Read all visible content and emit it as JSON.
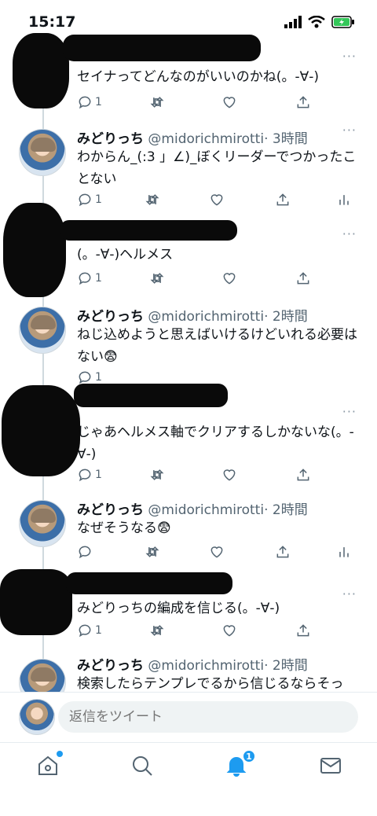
{
  "status_bar": {
    "time": "15:17"
  },
  "more_label": "···",
  "tweets": [
    {
      "name": "",
      "handle": "",
      "time": "",
      "text": "セイナってどんなのがいいのかね(。-∀-)",
      "reply_count": "1",
      "redacted": true
    },
    {
      "name": "みどりっち",
      "handle": "@midorichmirotti",
      "time": "· 3時間",
      "text": "わからん_(:3 」∠)_ぼくリーダーでつかったことない",
      "reply_count": "1",
      "redacted": false
    },
    {
      "name": "",
      "handle": "",
      "time": "",
      "text": "(。-∀-)ヘルメス",
      "reply_count": "1",
      "redacted": true
    },
    {
      "name": "みどりっち",
      "handle": "@midorichmirotti",
      "time": "· 2時間",
      "text": "ねじ込めようと思えばいけるけどいれる必要はない😨",
      "reply_count": "1",
      "redacted": false
    },
    {
      "name": "",
      "handle": "",
      "time": "",
      "text": "じゃあヘルメス軸でクリアするしかないな(。-∀-)",
      "reply_count": "1",
      "redacted": true
    },
    {
      "name": "みどりっち",
      "handle": "@midorichmirotti",
      "time": "· 2時間",
      "text": "なぜそうなる😨",
      "reply_count": "",
      "redacted": false
    },
    {
      "name": "",
      "handle": "",
      "time": "",
      "text": "みどりっちの編成を信じる(。-∀-)",
      "reply_count": "1",
      "redacted": true
    },
    {
      "name": "みどりっち",
      "handle": "@midorichmirotti",
      "time": "· 2時間",
      "text": "検索したらテンプレでるから信じるならそっ",
      "reply_count": "",
      "redacted": false
    }
  ],
  "reply": {
    "placeholder": "返信をツイート"
  },
  "tabs": {
    "notifications_badge": "1"
  },
  "icons": {
    "reply": "reply-icon",
    "retweet": "retweet-icon",
    "like": "like-icon",
    "share": "share-icon",
    "analytics": "analytics-icon",
    "home": "home-icon",
    "search": "search-icon",
    "notifications": "bell-icon",
    "messages": "mail-icon"
  },
  "colors": {
    "accent": "#1d9bf0",
    "text": "#0f1419",
    "muted": "#536471"
  }
}
